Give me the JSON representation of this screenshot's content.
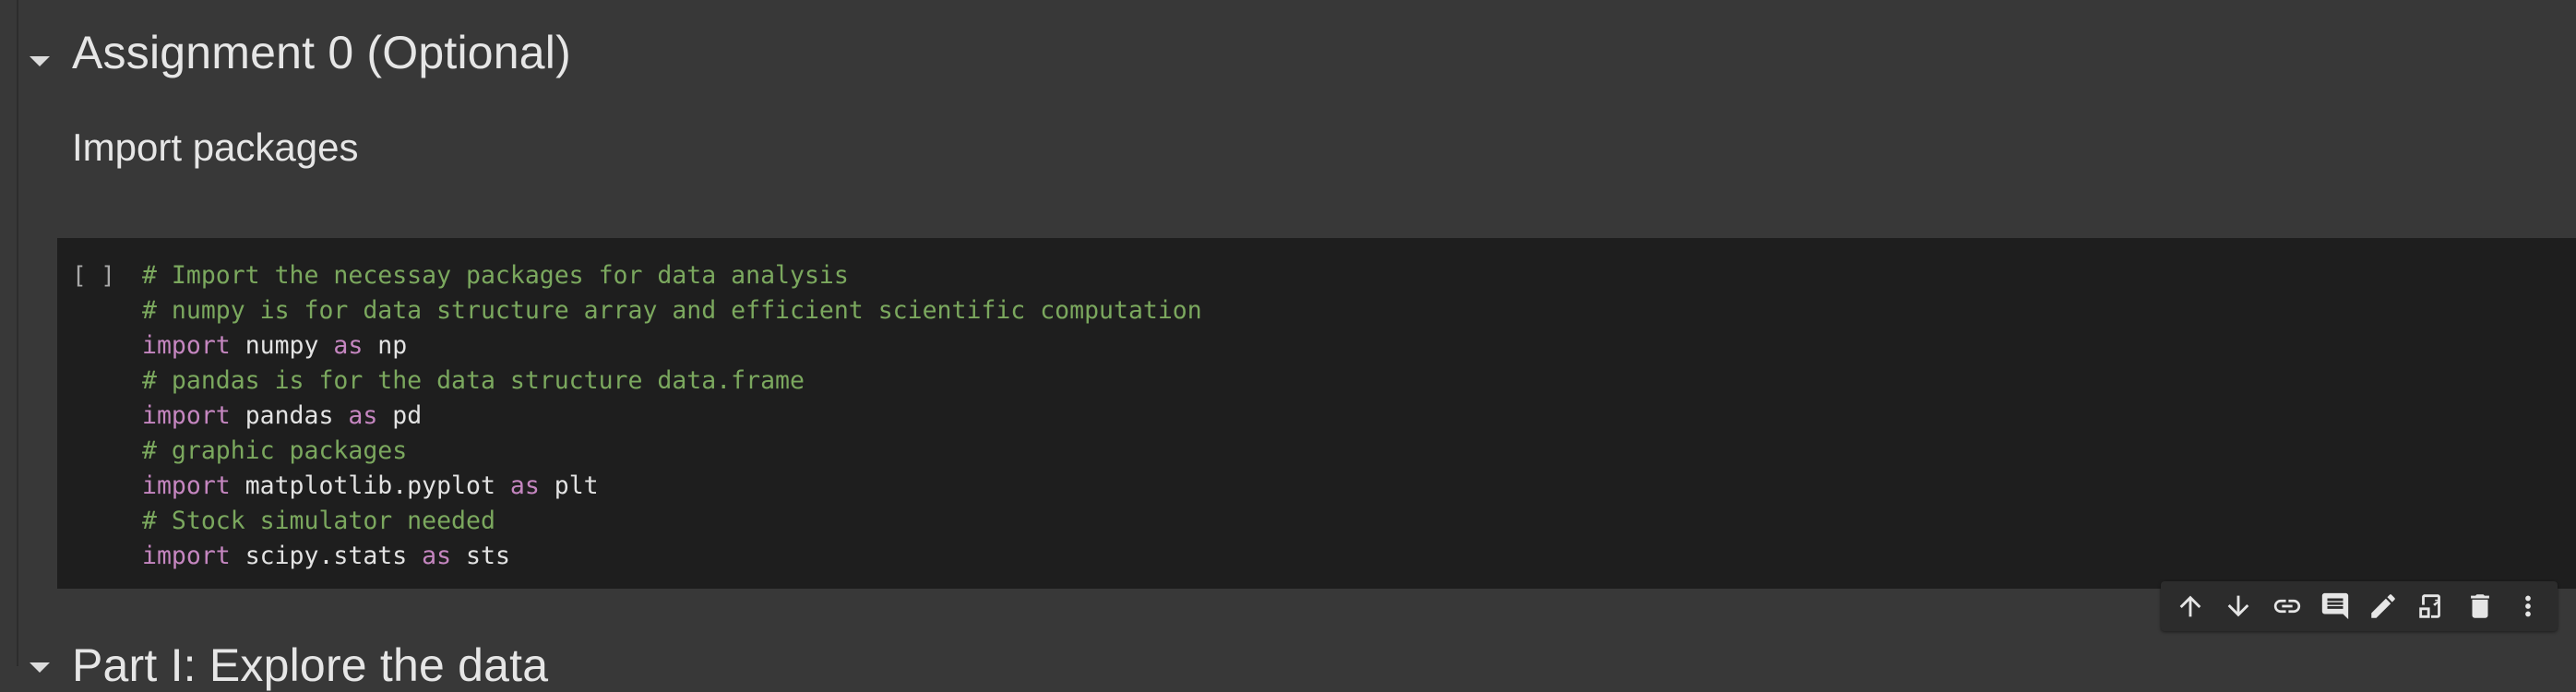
{
  "sections": {
    "assignment_title": "Assignment 0 (Optional)",
    "subsection_title": "Import packages",
    "next_section_title": "Part I: Explore the data"
  },
  "code_cell": {
    "run_indicator": "[ ]",
    "lines": [
      [
        {
          "t": "comment",
          "v": "# Import the necessay packages for data analysis"
        }
      ],
      [
        {
          "t": "comment",
          "v": "# numpy is for data structure array and efficient scientific computation"
        }
      ],
      [
        {
          "t": "keyword",
          "v": "import"
        },
        {
          "t": "plain",
          "v": " numpy "
        },
        {
          "t": "keyword",
          "v": "as"
        },
        {
          "t": "plain",
          "v": " np"
        }
      ],
      [
        {
          "t": "comment",
          "v": "# pandas is for the data structure data.frame"
        }
      ],
      [
        {
          "t": "keyword",
          "v": "import"
        },
        {
          "t": "plain",
          "v": " pandas "
        },
        {
          "t": "keyword",
          "v": "as"
        },
        {
          "t": "plain",
          "v": " pd"
        }
      ],
      [
        {
          "t": "comment",
          "v": "# graphic packages"
        }
      ],
      [
        {
          "t": "keyword",
          "v": "import"
        },
        {
          "t": "plain",
          "v": " matplotlib.pyplot "
        },
        {
          "t": "keyword",
          "v": "as"
        },
        {
          "t": "plain",
          "v": " plt"
        }
      ],
      [
        {
          "t": "comment",
          "v": "# Stock simulator needed"
        }
      ],
      [
        {
          "t": "keyword",
          "v": "import"
        },
        {
          "t": "plain",
          "v": " scipy.stats "
        },
        {
          "t": "keyword",
          "v": "as"
        },
        {
          "t": "plain",
          "v": " sts"
        }
      ]
    ]
  },
  "cell_toolbar": {
    "buttons": [
      {
        "name": "move-cell-up-button",
        "icon": "arrow-up-icon"
      },
      {
        "name": "move-cell-down-button",
        "icon": "arrow-down-icon"
      },
      {
        "name": "link-to-cell-button",
        "icon": "link-icon"
      },
      {
        "name": "add-comment-button",
        "icon": "comment-icon"
      },
      {
        "name": "edit-cell-button",
        "icon": "pencil-icon"
      },
      {
        "name": "mirror-cell-button",
        "icon": "mirror-tab-icon"
      },
      {
        "name": "delete-cell-button",
        "icon": "trash-icon"
      },
      {
        "name": "more-actions-button",
        "icon": "more-vert-icon"
      }
    ]
  },
  "colors": {
    "background": "#383838",
    "code_background": "#1e1e1e",
    "comment": "#7ba85e",
    "keyword": "#c586c0",
    "text": "#e3e3e3"
  }
}
